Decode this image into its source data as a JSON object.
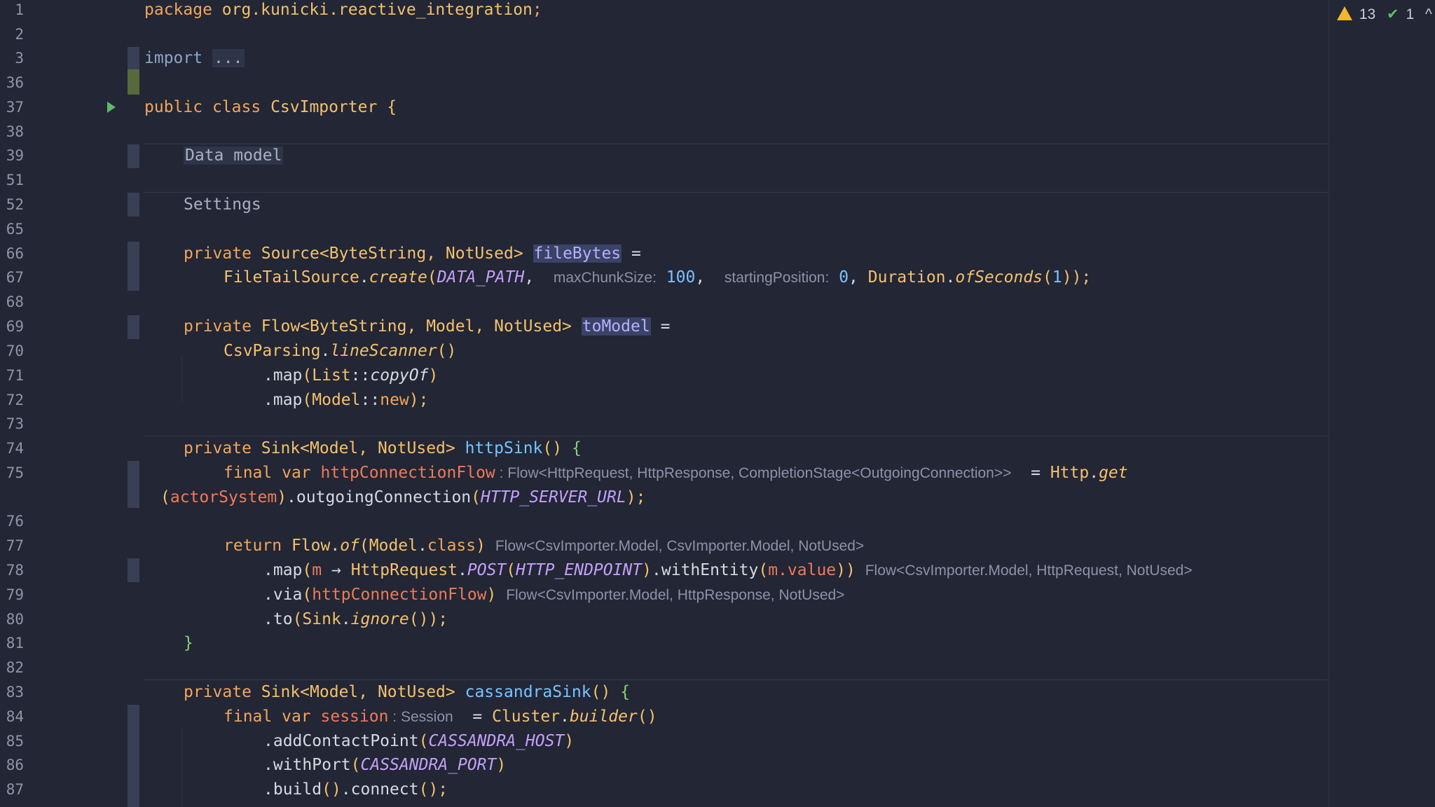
{
  "status": {
    "warnings": "13",
    "checks": "1",
    "warning_icon": "warning-triangle-icon",
    "check_icon": "double-check-icon",
    "collapse_icon": "chevron-up-icon"
  },
  "code": {
    "package_kw": "package",
    "package_name": "org.kunicki.reactive_integration",
    "import_kw": "import",
    "import_fold": "...",
    "class_public": "public",
    "class_kw": "class",
    "class_name": "CsvImporter",
    "fold_data_model": "Data model",
    "fold_settings": "Settings",
    "private": "private",
    "final": "final",
    "var": "var",
    "return": "return",
    "source_type": "Source<ByteString, NotUsed>",
    "file_bytes": "fileBytes",
    "filetail": "FileTailSource",
    "create": "create",
    "data_path": "DATA_PATH",
    "hint_max_chunk": "maxChunkSize:",
    "max_chunk_val": "100",
    "hint_starting": "startingPosition:",
    "starting_val": "0",
    "duration": "Duration",
    "of_seconds": "ofSeconds",
    "seconds_val": "1",
    "flow_type": "Flow<ByteString, Model, NotUsed>",
    "to_model": "toModel",
    "csv_parsing": "CsvParsing",
    "line_scanner": "lineScanner",
    "map": "map",
    "list": "List",
    "copy_of": "copyOf",
    "model": "Model",
    "new_kw": "new",
    "sink_type": "Sink<Model, NotUsed>",
    "http_sink": "httpSink",
    "http_conn_flow": "httpConnectionFlow",
    "hint_http_conn_type": "Flow<HttpRequest, HttpResponse, CompletionStage<OutgoingConnection>>",
    "http": "Http",
    "get": "get",
    "actor_system": "actorSystem",
    "outgoing_connection": "outgoingConnection",
    "http_server_url": "HTTP_SERVER_URL",
    "flow": "Flow",
    "of": "of",
    "model_class": "class",
    "hint_line77": "Flow<CsvImporter.Model, CsvImporter.Model, NotUsed>",
    "lambda_m": "m",
    "arrow": "→",
    "http_request": "HttpRequest",
    "post": "POST",
    "http_endpoint": "HTTP_ENDPOINT",
    "with_entity": "withEntity",
    "m_value": "m.value",
    "hint_line78": "Flow<CsvImporter.Model, HttpRequest, NotUsed>",
    "via": "via",
    "hint_line79": "Flow<CsvImporter.Model, HttpResponse, NotUsed>",
    "to": "to",
    "sink": "Sink",
    "ignore": "ignore",
    "cassandra_sink": "cassandraSink",
    "session": "session",
    "hint_session": "Session",
    "cluster": "Cluster",
    "builder": "builder",
    "add_contact_point": "addContactPoint",
    "cassandra_host": "CASSANDRA_HOST",
    "with_port": "withPort",
    "cassandra_port": "CASSANDRA_PORT",
    "build": "build",
    "connect": "connect"
  },
  "line_numbers": [
    "1",
    "2",
    "3",
    "36",
    "37",
    "38",
    "39",
    "51",
    "52",
    "65",
    "66",
    "67",
    "68",
    "69",
    "70",
    "71",
    "72",
    "73",
    "74",
    "75",
    "76",
    "77",
    "78",
    "79",
    "80",
    "81",
    "82",
    "83",
    "84",
    "85",
    "86",
    "87"
  ],
  "colors": {
    "background": "#222635",
    "keyword": "#f2a65a",
    "type": "#f4c16b",
    "function": "#78c4ff",
    "constant": "#c4a0f8",
    "number": "#7ec0ff",
    "local_var": "#f07a58",
    "hint": "#8b93a7",
    "warning": "#f3b52a",
    "check": "#5fba6b"
  }
}
